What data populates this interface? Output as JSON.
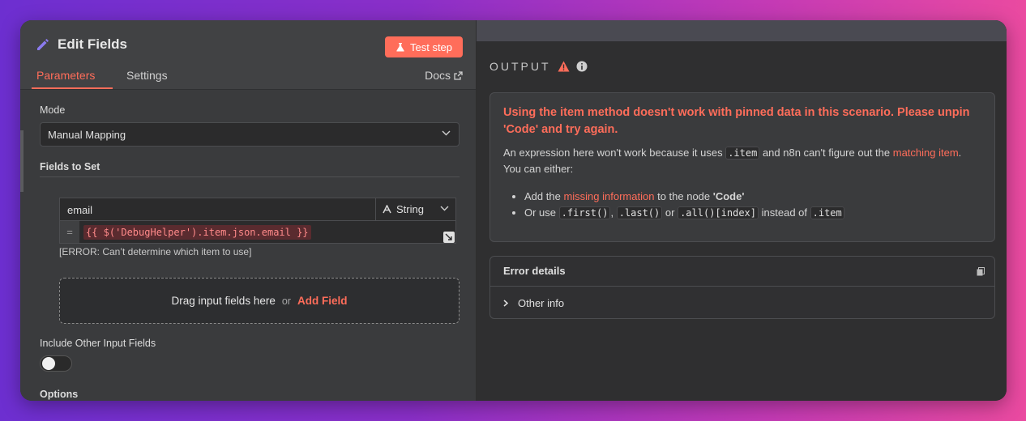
{
  "left_panel": {
    "title": "Edit Fields",
    "test_button_label": "Test step",
    "tabs": [
      {
        "label": "Parameters",
        "active": true
      },
      {
        "label": "Settings",
        "active": false
      }
    ],
    "docs_label": "Docs",
    "mode_label": "Mode",
    "mode_value": "Manual Mapping",
    "fields_to_set_label": "Fields to Set",
    "field": {
      "name": "email",
      "type": "String",
      "expression": "{{ $('DebugHelper').item.json.email }}",
      "error": "[ERROR: Can’t determine which item to use]"
    },
    "dropzone_text": "Drag input fields here",
    "dropzone_or": "or",
    "add_field_label": "Add Field",
    "include_other_label": "Include Other Input Fields",
    "include_other_enabled": false,
    "options_label": "Options"
  },
  "output_panel": {
    "header": "OUTPUT",
    "error": {
      "title": "Using the item method doesn't work with pinned data in this scenario. Please unpin 'Code' and try again.",
      "desc_1": "An expression here won't work because it uses",
      "desc_code": ".item",
      "desc_2": "and n8n can't figure out the",
      "desc_link": "matching item",
      "desc_3": ". You can either:",
      "bullet1_prefix": "Add the",
      "bullet1_link": "missing information",
      "bullet1_suffix": "to the node",
      "bullet1_node": "'Code'",
      "bullet2_prefix": "Or use",
      "bullet2_code1": ".first()",
      "bullet2_sep": ",",
      "bullet2_code2": ".last()",
      "bullet2_or": "or",
      "bullet2_code3": ".all()[index]",
      "bullet2_instead": "instead of",
      "bullet2_code4": ".item"
    },
    "details_title": "Error details",
    "other_info_label": "Other info"
  },
  "colors": {
    "accent": "#ff6d5a",
    "panel_bg": "#414244",
    "output_bg": "#2f2f30"
  }
}
